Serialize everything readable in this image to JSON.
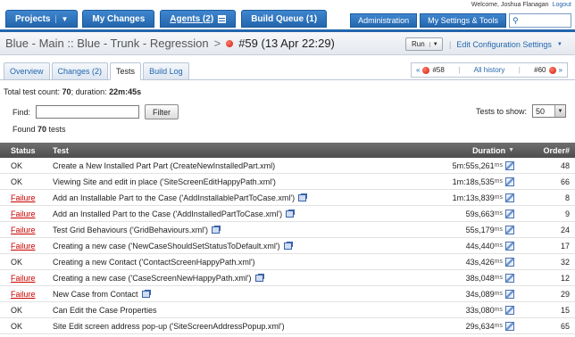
{
  "topnav": {
    "tabs": [
      {
        "label": "Projects",
        "has_dropdown": true
      },
      {
        "label": "My Changes"
      },
      {
        "label": "Agents (2)",
        "underlined": true
      },
      {
        "label": "Build Queue (1)"
      }
    ],
    "welcome_text": "Welcome, Joshua Flanagan",
    "logout_label": "Logout",
    "administration_label": "Administration",
    "settings_label": "My Settings & Tools",
    "search_icon": "search-icon"
  },
  "breadcrumb": {
    "project": "Blue - Main :: Blue - Trunk - Regression",
    "separator": ">",
    "build": "#59 (13 Apr 22:29)",
    "status_color": "#d01c0c"
  },
  "actions": {
    "run_label": "Run",
    "edit_config_label": "Edit Configuration Settings"
  },
  "tabs": [
    {
      "label": "Overview",
      "active": false
    },
    {
      "label": "Changes (2)",
      "active": false
    },
    {
      "label": "Tests",
      "active": true
    },
    {
      "label": "Build Log",
      "active": false
    }
  ],
  "build_nav": {
    "prev_label": "#58",
    "all_history_label": "All history",
    "next_label": "#60"
  },
  "summary": {
    "count_prefix": "Total test count: ",
    "count": "70",
    "duration_prefix": "; duration: ",
    "duration": "22m:45s",
    "find_label": "Find:",
    "find_value": "",
    "filter_label": "Filter",
    "tests_to_show_label": "Tests to show:",
    "tests_to_show_value": "50",
    "found_prefix": "Found ",
    "found_count": "70",
    "found_suffix": " tests"
  },
  "table": {
    "headers": {
      "status": "Status",
      "test": "Test",
      "duration": "Duration",
      "order": "Order#"
    },
    "rows": [
      {
        "status": "OK",
        "test": "Create a New Installed Part Part (CreateNewInstalledPart.xml)",
        "stack": false,
        "dur": "5m:55s,261",
        "unit": "ms",
        "order": "48"
      },
      {
        "status": "OK",
        "test": "Viewing Site and edit in place ('SiteScreenEditHappyPath.xml')",
        "stack": false,
        "dur": "1m:18s,535",
        "unit": "ms",
        "order": "66"
      },
      {
        "status": "Failure",
        "test": "Add an Installable Part to the Case ('AddInstallablePartToCase.xml')",
        "stack": true,
        "dur": "1m:13s,839",
        "unit": "ms",
        "order": "8"
      },
      {
        "status": "Failure",
        "test": "Add an Installed Part to the Case ('AddInstalledPartToCase.xml')",
        "stack": true,
        "dur": "59s,663",
        "unit": "ms",
        "order": "9"
      },
      {
        "status": "Failure",
        "test": "Test Grid Behaviours ('GridBehaviours.xml')",
        "stack": true,
        "dur": "55s,179",
        "unit": "ms",
        "order": "24"
      },
      {
        "status": "Failure",
        "test": "Creating a new case ('NewCaseShouldSetStatusToDefault.xml')",
        "stack": true,
        "dur": "44s,440",
        "unit": "ms",
        "order": "17"
      },
      {
        "status": "OK",
        "test": "Creating a new Contact ('ContactScreenHappyPath.xml')",
        "stack": false,
        "dur": "43s,426",
        "unit": "ms",
        "order": "32"
      },
      {
        "status": "Failure",
        "test": "Creating a new case ('CaseScreenNewHappyPath.xml')",
        "stack": true,
        "dur": "38s,048",
        "unit": "ms",
        "order": "12"
      },
      {
        "status": "Failure",
        "test": "New Case from Contact",
        "stack": true,
        "dur": "34s,089",
        "unit": "ms",
        "order": "29"
      },
      {
        "status": "OK",
        "test": "Can Edit the Case Properties",
        "stack": false,
        "dur": "33s,080",
        "unit": "ms",
        "order": "15"
      },
      {
        "status": "OK",
        "test": "Site Edit screen address pop-up ('SiteScreenAddressPopup.xml')",
        "stack": false,
        "dur": "29s,634",
        "unit": "ms",
        "order": "65"
      }
    ]
  }
}
